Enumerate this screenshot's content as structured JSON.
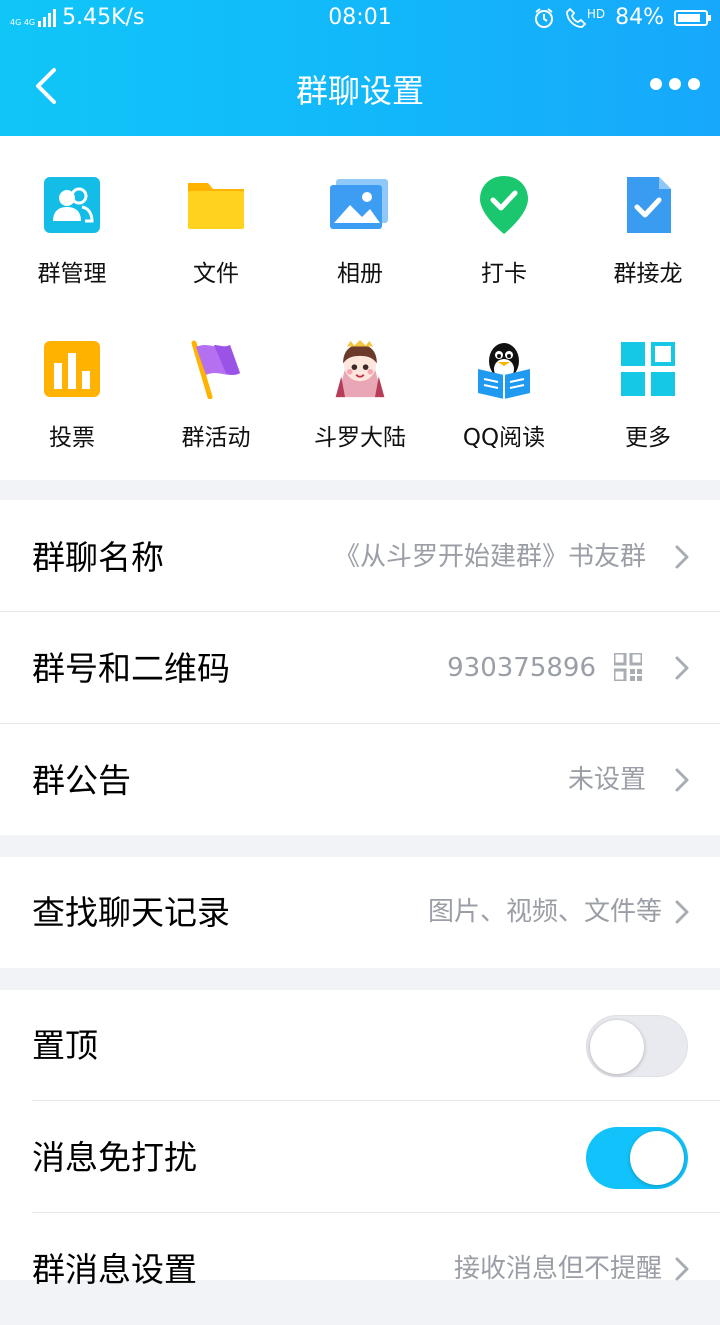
{
  "status_bar": {
    "network": "4G 4G",
    "speed": "5.45K/s",
    "time": "08:01",
    "hd": "HD",
    "battery": "84%",
    "battery_level": 0.84
  },
  "header": {
    "title": "群聊设置"
  },
  "apps": [
    {
      "label": "群管理",
      "icon": "group-manage-icon"
    },
    {
      "label": "文件",
      "icon": "folder-icon"
    },
    {
      "label": "相册",
      "icon": "album-icon"
    },
    {
      "label": "打卡",
      "icon": "check-in-icon"
    },
    {
      "label": "群接龙",
      "icon": "relay-icon"
    },
    {
      "label": "投票",
      "icon": "vote-icon"
    },
    {
      "label": "群活动",
      "icon": "flag-icon"
    },
    {
      "label": "斗罗大陆",
      "icon": "douluo-icon"
    },
    {
      "label": "QQ阅读",
      "icon": "qq-read-icon"
    },
    {
      "label": "更多",
      "icon": "more-grid-icon"
    }
  ],
  "settings": {
    "group_name": {
      "label": "群聊名称",
      "value": "《从斗罗开始建群》书友群"
    },
    "group_number": {
      "label": "群号和二维码",
      "value": "930375896"
    },
    "announcement": {
      "label": "群公告",
      "value": "未设置"
    },
    "search_history": {
      "label": "查找聊天记录",
      "value": "图片、视频、文件等"
    },
    "pin_top": {
      "label": "置顶",
      "on": false
    },
    "do_not_disturb": {
      "label": "消息免打扰",
      "on": true
    },
    "message_settings": {
      "label": "群消息设置",
      "value": "接收消息但不提醒"
    }
  },
  "colors": {
    "accent": "#12b8fa",
    "toggle_on": "#12c3fb",
    "toggle_off": "#e8eaef",
    "secondary_text": "#9a9ea6"
  }
}
